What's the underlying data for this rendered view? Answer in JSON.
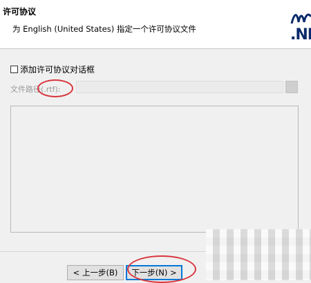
{
  "header": {
    "title": "许可协议",
    "subtitle": "为 English (United States) 指定一个许可协议文件",
    "logo_text": ".NE"
  },
  "form": {
    "checkbox_label": "添加许可协议对话框",
    "checkbox_checked": false,
    "path_label": "文件路径(.rtf):",
    "path_value": ""
  },
  "buttons": {
    "back_label": "< 上一步(B)",
    "next_label": "下一步(N) >"
  },
  "colors": {
    "annotation": "#d9353d",
    "focus": "#0078d7",
    "logo": "#0b2a6b"
  }
}
